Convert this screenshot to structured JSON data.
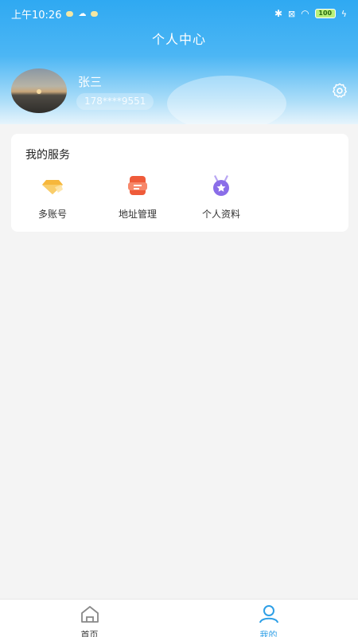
{
  "status_bar": {
    "time": "上午10:26",
    "battery": "100"
  },
  "header": {
    "title": "个人中心"
  },
  "profile": {
    "name": "张三",
    "phone": "178****9551"
  },
  "services": {
    "title": "我的服务",
    "items": [
      {
        "label": "多账号",
        "icon": "diamond-icon"
      },
      {
        "label": "地址管理",
        "icon": "address-icon"
      },
      {
        "label": "个人资料",
        "icon": "medal-icon"
      }
    ]
  },
  "tabbar": {
    "items": [
      {
        "label": "首页",
        "icon": "home-icon",
        "active": false
      },
      {
        "label": "我的",
        "icon": "user-icon",
        "active": true
      }
    ]
  },
  "colors": {
    "header_blue": "#2fa9f2",
    "active_tab": "#2e9fe6",
    "diamond": "#f6b73c",
    "address": "#ef5b3a",
    "medal": "#8a6de8"
  }
}
